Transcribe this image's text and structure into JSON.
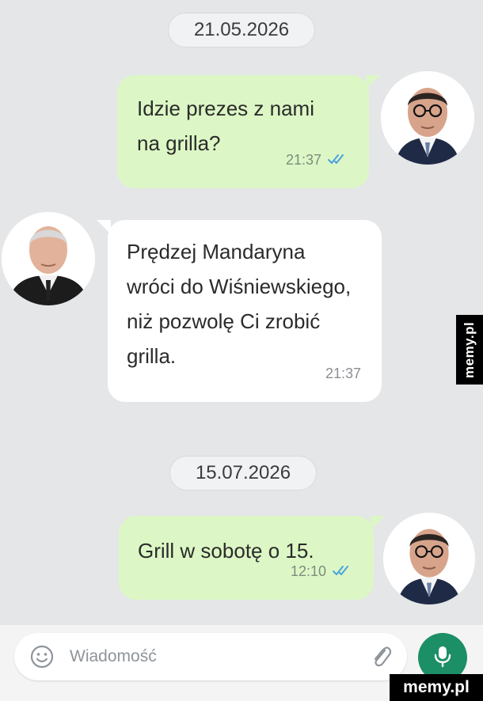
{
  "chat": {
    "date_1": "21.05.2026",
    "date_2": "15.07.2026",
    "messages": [
      {
        "direction": "outgoing",
        "text": "Idzie prezes z nami\nna grilla?",
        "time": "21:37",
        "read_icon": "double-check-icon"
      },
      {
        "direction": "incoming",
        "text": "Prędzej Mandaryna\nwróci do Wiśniewskiego,\nniż pozwolę Ci zrobić\ngrilla.",
        "time": "21:37"
      },
      {
        "direction": "outgoing",
        "text": "Grill w sobotę o 15.",
        "time": "12:10",
        "read_icon": "double-check-icon"
      }
    ]
  },
  "composer": {
    "placeholder": "Wiadomość",
    "emoji_icon": "smiley-icon",
    "attach_icon": "paperclip-icon",
    "mic_icon": "microphone-icon"
  },
  "watermark": {
    "side": "memy.pl",
    "corner": "memy.pl"
  },
  "colors": {
    "background": "#e5e6e8",
    "outgoing_bubble": "#dcf7c5",
    "incoming_bubble": "#ffffff",
    "read_check": "#4aa3e0",
    "mic_button": "#1c8f66"
  }
}
